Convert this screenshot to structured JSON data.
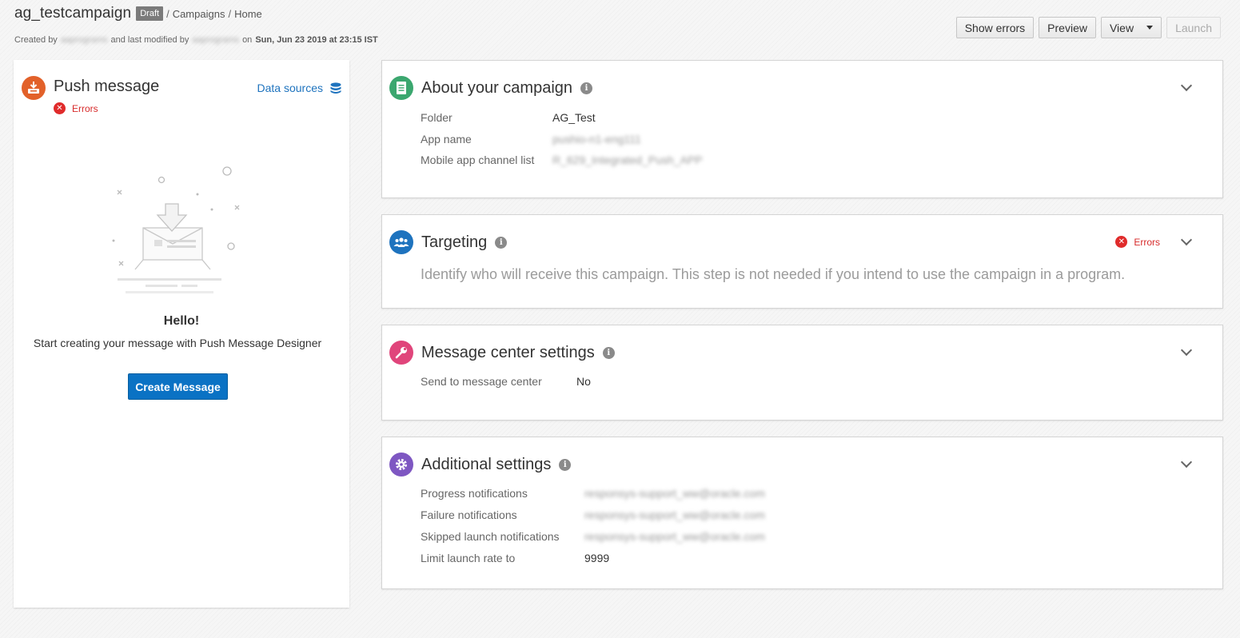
{
  "header": {
    "campaign_name": "ag_testcampaign",
    "status_badge": "Draft",
    "breadcrumb": [
      {
        "sep": "/",
        "label": "Campaigns"
      },
      {
        "sep": "/",
        "label": "Home"
      }
    ],
    "meta": {
      "created_by_label": "Created by",
      "created_by": "aaprograms",
      "modified_label": "and last modified by",
      "modified_by": "aaprograms",
      "on_label": "on",
      "date": "Sun, Jun 23 2019 at 23:15 IST"
    }
  },
  "toolbar": {
    "show_errors": "Show errors",
    "preview": "Preview",
    "view": "View",
    "launch": "Launch"
  },
  "push_panel": {
    "title": "Push message",
    "errors_label": "Errors",
    "data_sources": "Data sources",
    "hello": "Hello!",
    "subtitle": "Start creating your message with Push Message Designer",
    "create_button": "Create Message",
    "icon_color": "#e2612a"
  },
  "about": {
    "title": "About your campaign",
    "icon_color": "#3ba76f",
    "fields": [
      {
        "label": "Folder",
        "value": "AG_Test"
      },
      {
        "label": "App name",
        "value": "pushio-n1-eng111"
      },
      {
        "label": "Mobile app channel list",
        "value": "R_629_Integrated_Push_APP"
      }
    ]
  },
  "targeting": {
    "title": "Targeting",
    "icon_color": "#1e73be",
    "errors_label": "Errors",
    "description": "Identify who will receive this campaign. This step is not needed if you intend to use the campaign in a program."
  },
  "message_center": {
    "title": "Message center settings",
    "icon_color": "#e0457b",
    "fields": [
      {
        "label": "Send to message center",
        "value": "No"
      }
    ]
  },
  "additional": {
    "title": "Additional settings",
    "icon_color": "#7e57c2",
    "fields": [
      {
        "label": "Progress notifications",
        "value": "responsys-support_ww@oracle.com"
      },
      {
        "label": "Failure notifications",
        "value": "responsys-support_ww@oracle.com"
      },
      {
        "label": "Skipped launch notifications",
        "value": "responsys-support_ww@oracle.com"
      },
      {
        "label": "Limit launch rate to",
        "value": "9999"
      }
    ]
  },
  "icons": {
    "push": "push-inbox-icon",
    "data_sources": "database-icon",
    "about": "document-icon",
    "targeting": "people-icon",
    "message_center": "wrench-icon",
    "additional": "gear-icon",
    "info": "info-icon",
    "expand": "chevron-down-icon",
    "error": "error-x-icon",
    "view_dropdown": "caret-down-icon"
  }
}
